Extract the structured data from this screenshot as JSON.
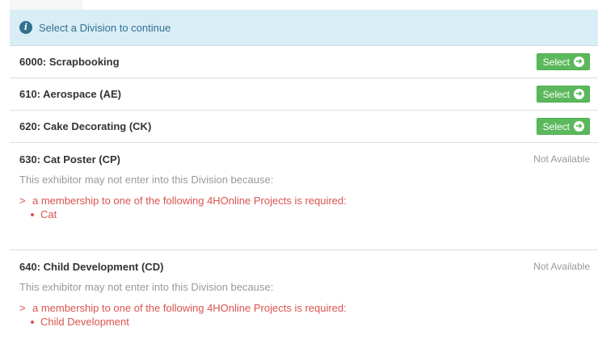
{
  "alert": {
    "text": "Select a Division to continue"
  },
  "divisions": [
    {
      "title": "6000: Scrapbooking",
      "action": "Select"
    },
    {
      "title": "610: Aerospace (AE)",
      "action": "Select"
    },
    {
      "title": "620: Cake Decorating (CK)",
      "action": "Select"
    },
    {
      "title": "630: Cat Poster (CP)",
      "status": "Not Available",
      "reason_intro": "This exhibitor may not enter into this Division because:",
      "reason": "a membership to one of the following 4HOnline Projects is required:",
      "projects": [
        "Cat"
      ]
    },
    {
      "title": "640: Child Development (CD)",
      "status": "Not Available",
      "reason_intro": "This exhibitor may not enter into this Division because:",
      "reason": "a membership to one of the following 4HOnline Projects is required:",
      "projects": [
        "Child Development"
      ]
    }
  ],
  "colors": {
    "alert_bg": "#d9edf7",
    "alert_text": "#31708f",
    "select_button": "#5cb85c",
    "error_text": "#d9534f",
    "muted_text": "#999999"
  },
  "icons": {
    "alert": "info-circle-icon",
    "select": "arrow-circle-right-icon",
    "reason": "chevron-right-icon",
    "project": "bullet-icon"
  }
}
